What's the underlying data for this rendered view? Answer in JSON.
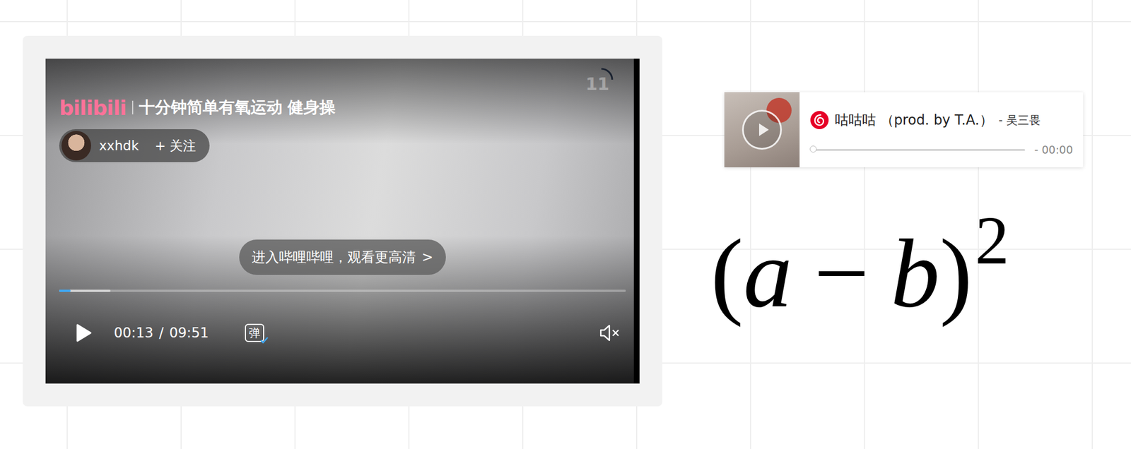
{
  "video": {
    "logo": "bilibili",
    "title": "十分钟简单有氧运动 健身操",
    "uploader": "xxhdk",
    "follow": "+ 关注",
    "hd_prompt": "进入哔哩哔哩，观看更高清",
    "prompt_arrow": ">",
    "countdown": "11",
    "playing": false,
    "played_level": 0.02,
    "buffered_level": 0.09,
    "current_time": "00:13",
    "separator": "/",
    "duration": "09:51",
    "danmaku": {
      "label": "弹",
      "on": true
    },
    "muted": true
  },
  "music": {
    "title": "咕咕咕 （prod. by T.A.）",
    "artist": "- 吴三畏",
    "time": "- 00:00",
    "level": 0,
    "playing": false
  },
  "formula": {
    "base": [
      {
        "text": "(",
        "kind": "symbol"
      },
      {
        "text": "a",
        "kind": "variable"
      },
      {
        "text": "−",
        "kind": "operator"
      },
      {
        "text": "b",
        "kind": "variable"
      },
      {
        "text": ")",
        "kind": "symbol"
      }
    ],
    "exponent": "2"
  }
}
